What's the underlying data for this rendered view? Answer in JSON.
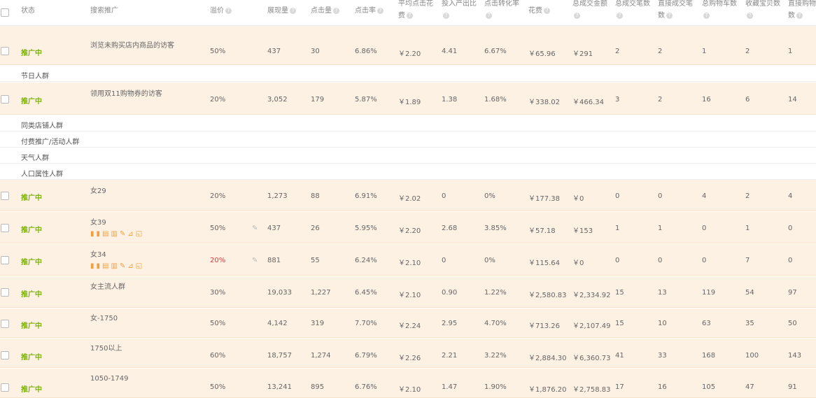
{
  "headers": {
    "status": "状态",
    "search": "搜索推广",
    "premium": "溢价",
    "impressions": "展现量",
    "clicks": "点击量",
    "ctr": "点击率",
    "avgcpc_l1": "平均点击花",
    "avgcpc_l2": "费",
    "roi": "投入产出比",
    "cvr": "点击转化率",
    "cost": "花费",
    "total_gmv": "总成交金额",
    "total_orders": "总成交笔数",
    "direct_orders_l1": "直接成交笔",
    "direct_orders_l2": "数",
    "cart": "总购物车数",
    "fav": "收藏宝贝数",
    "direct_cart_l1": "直接购物车",
    "direct_cart_l2": "数"
  },
  "help_glyph": "?",
  "groups": [
    "节日人群",
    "同类店铺人群",
    "付费推广/活动人群",
    "天气人群",
    "人口属性人群"
  ],
  "rows": [
    {
      "status": "推广中",
      "name": "浏览未购买店内商品的访客",
      "premium": "50%",
      "impressions": "437",
      "clicks": "30",
      "ctr": "6.86%",
      "cpc": "￥2.20",
      "roi": "4.41",
      "cvr": "6.67%",
      "cost": "￥65.96",
      "gmv": "￥291",
      "orders": "2",
      "direct_orders": "2",
      "cart": "1",
      "fav": "2",
      "direct_cart": "1"
    },
    {
      "status": "推广中",
      "name": "领用双11购物券的访客",
      "premium": "20%",
      "impressions": "3,052",
      "clicks": "179",
      "ctr": "5.87%",
      "cpc": "￥1.89",
      "roi": "1.38",
      "cvr": "1.68%",
      "cost": "￥338.02",
      "gmv": "￥466.34",
      "orders": "3",
      "direct_orders": "2",
      "cart": "16",
      "fav": "6",
      "direct_cart": "14"
    },
    {
      "status": "推广中",
      "name": "女29",
      "premium": "20%",
      "impressions": "1,273",
      "clicks": "88",
      "ctr": "6.91%",
      "cpc": "￥2.02",
      "roi": "0",
      "cvr": "0%",
      "cost": "￥177.38",
      "gmv": "￥0",
      "orders": "0",
      "direct_orders": "0",
      "cart": "4",
      "fav": "2",
      "direct_cart": "4"
    },
    {
      "status": "推广中",
      "name": "女39",
      "premium": "50%",
      "impressions": "437",
      "clicks": "26",
      "ctr": "5.95%",
      "cpc": "￥2.20",
      "roi": "2.68",
      "cvr": "3.85%",
      "cost": "￥57.18",
      "gmv": "￥153",
      "orders": "1",
      "direct_orders": "1",
      "cart": "0",
      "fav": "1",
      "direct_cart": "0"
    },
    {
      "status": "推广中",
      "name": "女34",
      "premium": "20%",
      "impressions": "881",
      "clicks": "55",
      "ctr": "6.24%",
      "cpc": "￥2.10",
      "roi": "0",
      "cvr": "0%",
      "cost": "￥115.64",
      "gmv": "￥0",
      "orders": "0",
      "direct_orders": "0",
      "cart": "0",
      "fav": "7",
      "direct_cart": "0"
    },
    {
      "status": "推广中",
      "name": "女主流人群",
      "premium": "30%",
      "impressions": "19,033",
      "clicks": "1,227",
      "ctr": "6.45%",
      "cpc": "￥2.10",
      "roi": "0.90",
      "cvr": "1.22%",
      "cost": "￥2,580.83",
      "gmv": "￥2,334.92",
      "orders": "15",
      "direct_orders": "13",
      "cart": "119",
      "fav": "54",
      "direct_cart": "97"
    },
    {
      "status": "推广中",
      "name": "女-1750",
      "premium": "50%",
      "impressions": "4,142",
      "clicks": "319",
      "ctr": "7.70%",
      "cpc": "￥2.24",
      "roi": "2.95",
      "cvr": "4.70%",
      "cost": "￥713.26",
      "gmv": "￥2,107.49",
      "orders": "15",
      "direct_orders": "10",
      "cart": "63",
      "fav": "35",
      "direct_cart": "50"
    },
    {
      "status": "推广中",
      "name": "1750以上",
      "premium": "60%",
      "impressions": "18,757",
      "clicks": "1,274",
      "ctr": "6.79%",
      "cpc": "￥2.26",
      "roi": "2.21",
      "cvr": "3.22%",
      "cost": "￥2,884.30",
      "gmv": "￥6,360.73",
      "orders": "41",
      "direct_orders": "33",
      "cart": "168",
      "fav": "100",
      "direct_cart": "143"
    },
    {
      "status": "推广中",
      "name": "1050-1749",
      "premium": "50%",
      "impressions": "13,241",
      "clicks": "895",
      "ctr": "6.76%",
      "cpc": "￥2.10",
      "roi": "1.47",
      "cvr": "1.90%",
      "cost": "￥1,876.20",
      "gmv": "￥2,758.83",
      "orders": "17",
      "direct_orders": "16",
      "cart": "105",
      "fav": "47",
      "direct_cart": "91"
    }
  ],
  "icons": {
    "pencil": "pencil-icon",
    "tools": [
      "pause-icon",
      "clipboard-icon",
      "delete-icon",
      "edit-icon",
      "chart-icon",
      "report-icon"
    ]
  },
  "colors": {
    "row_bg": "#fdf1e3",
    "status": "#7cb305",
    "premium_highlight": "#e4393c",
    "tool_icon": "#f0a040"
  }
}
